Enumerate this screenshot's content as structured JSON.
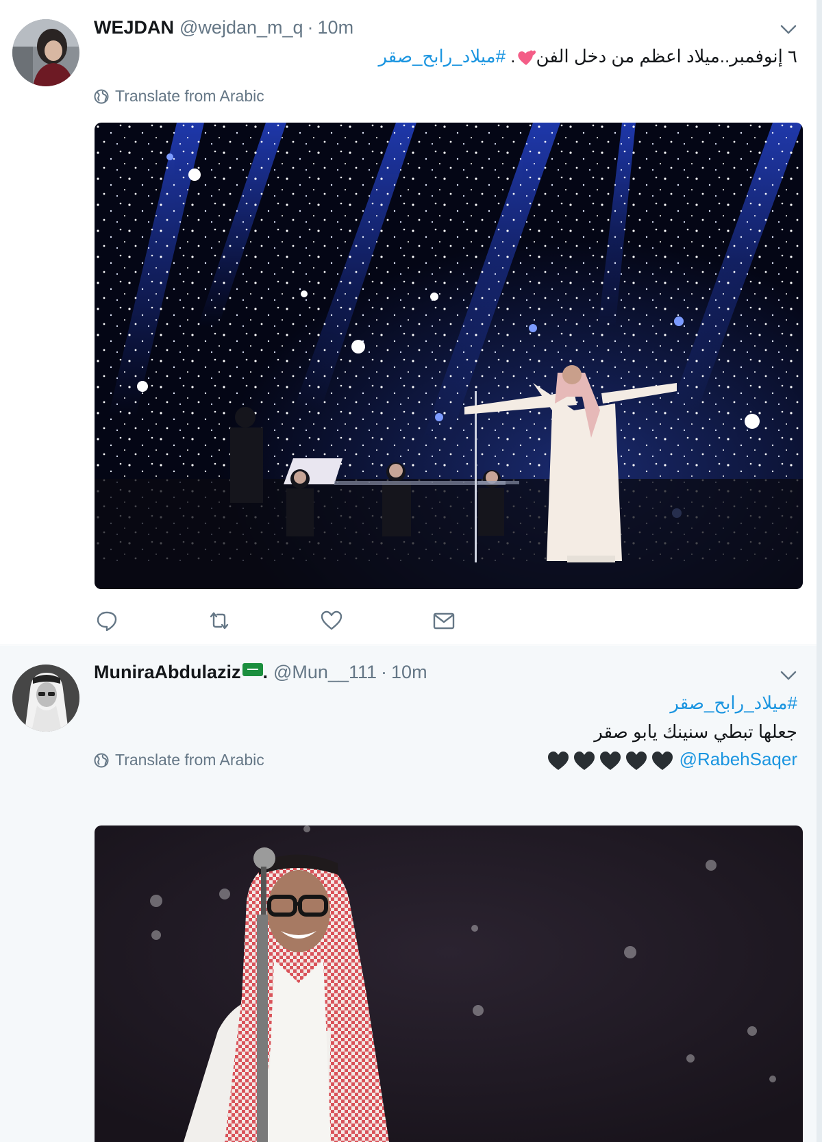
{
  "tweets": [
    {
      "name": "WEJDAN",
      "handle": "@wejdan_m_q",
      "separator": "·",
      "time": "10m",
      "text_plain": "٦ إنوفمبر..ميلاد اعظم من دخل الفن",
      "text_punct": ". ",
      "hashtag": "#ميلاد_رابح_صقر",
      "translate_label": "Translate from Arabic",
      "media_alt": "Concert stage with starry blue backdrop, singer with open arms and orchestra",
      "actions": [
        "reply-icon",
        "retweet-icon",
        "like-icon",
        "message-icon"
      ]
    },
    {
      "name": "MuniraAbdulaziz",
      "name_suffix": ".",
      "handle": "@Mun__111",
      "separator": "·",
      "time": "10m",
      "hashtag": "#ميلاد_رابح_صقر",
      "line2": "جعلها تبطي سنينك يابو صقر",
      "mention": "@RabehSaqer",
      "translate_label": "Translate from Arabic",
      "media_alt": "Smiling singer in red and white shemagh at a microphone"
    }
  ],
  "colors": {
    "link": "#1b95e0",
    "secondary_text": "#657786",
    "alt_background": "#f5f8fa"
  }
}
